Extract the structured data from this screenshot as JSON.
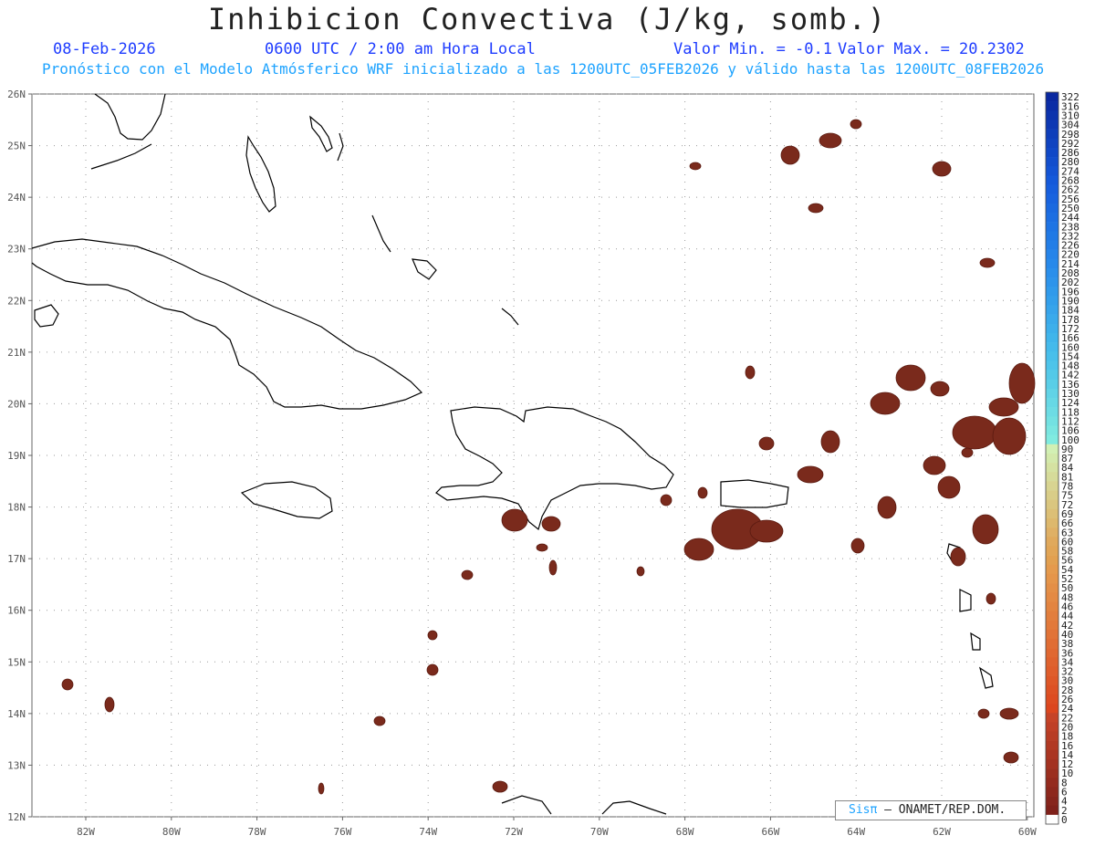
{
  "header": {
    "title": "Inhibicion Convectiva (J/kg, somb.)",
    "date": "08-Feb-2026",
    "time": "0600 UTC / 2:00 am Hora Local",
    "min_label": "Valor Min. = -0.1",
    "max_label": "Valor Max. = 20.2302",
    "forecast_line": "Pronóstico con el Modelo Atmósferico WRF inicializado a las 1200UTC_05FEB2026 y válido hasta las  1200UTC_08FEB2026"
  },
  "map": {
    "lat_labels": [
      "26N",
      "25N",
      "24N",
      "23N",
      "22N",
      "21N",
      "20N",
      "19N",
      "18N",
      "17N",
      "16N",
      "15N",
      "14N",
      "13N",
      "12N"
    ],
    "lon_labels": [
      "82W",
      "80W",
      "78W",
      "76W",
      "74W",
      "72W",
      "70W",
      "68W",
      "66W",
      "64W",
      "62W",
      "60W"
    ],
    "colors": {
      "land_outline": "#000000",
      "grid": "#9a9a9a",
      "cin_fill": "#7a2a1c",
      "cin_edge": "#5a1a10"
    }
  },
  "colorbar": {
    "labels": [
      "322",
      "316",
      "310",
      "304",
      "298",
      "292",
      "286",
      "280",
      "274",
      "268",
      "262",
      "256",
      "250",
      "244",
      "238",
      "232",
      "226",
      "220",
      "214",
      "208",
      "202",
      "196",
      "190",
      "184",
      "178",
      "172",
      "166",
      "160",
      "154",
      "148",
      "142",
      "136",
      "130",
      "124",
      "118",
      "112",
      "106",
      "100",
      "90",
      "87",
      "84",
      "81",
      "78",
      "75",
      "72",
      "69",
      "66",
      "63",
      "60",
      "58",
      "56",
      "54",
      "52",
      "50",
      "48",
      "46",
      "44",
      "42",
      "40",
      "38",
      "36",
      "34",
      "32",
      "30",
      "28",
      "26",
      "24",
      "22",
      "20",
      "18",
      "16",
      "14",
      "12",
      "10",
      "8",
      "6",
      "4",
      "2",
      "0"
    ]
  },
  "footer": {
    "logo": "Sisπ",
    "credit": "– ONAMET/REP.DOM."
  }
}
